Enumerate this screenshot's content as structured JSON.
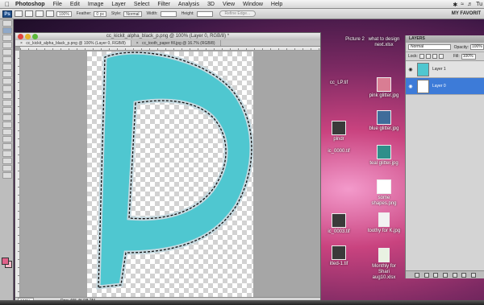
{
  "menubar": {
    "app": "Photoshop",
    "items": [
      "File",
      "Edit",
      "Image",
      "Layer",
      "Select",
      "Filter",
      "Analysis",
      "3D",
      "View",
      "Window",
      "Help"
    ],
    "clock": "Tu"
  },
  "options": {
    "app_badge": "Ps",
    "zoom": "100%",
    "feather_label": "Feather:",
    "feather_value": "0 px",
    "style_label": "Style:",
    "style_value": "Normal",
    "width_label": "Width:",
    "height_label": "Height:",
    "refine_edge_label": "Refine Edge...",
    "workspace": "MY FAVORIT"
  },
  "document": {
    "title": "cc_kickit_alpha_black_p.png @ 100% (Layer 0, RGB/8) *",
    "tabs": [
      {
        "label": "cc_kickit_alpha_black_p.png @ 100% (Layer 0, RGB/8)"
      },
      {
        "label": "cc_tooth_paper fill.jpg @ 16.7% (RGB/8)"
      }
    ],
    "status_zoom": "100%",
    "status_doc": "Doc: 455.4K/38.2M"
  },
  "desktop_icons": [
    {
      "label": "Picture 2"
    },
    {
      "label": "what to design next.xlsx"
    },
    {
      "label": "pink glitter.jpg"
    },
    {
      "label": "blue glitter.jpg"
    },
    {
      "label": "teal glitter.jpg"
    },
    {
      "label": "some shapes.png"
    },
    {
      "label": "toothy for K.jpg"
    },
    {
      "label": "Monthly for Shari aug10.xlsx"
    },
    {
      "label": "cc_LP.tif"
    },
    {
      "label": "plndr"
    },
    {
      "label": "ic_0000.tif"
    },
    {
      "label": "ic_0003.tif"
    },
    {
      "label": "itled-1.tif"
    }
  ],
  "layers_panel": {
    "title": "LAYERS",
    "blend_mode": "Normal",
    "opacity_label": "Opacity:",
    "opacity_value": "100%",
    "lock_label": "Lock:",
    "fill_label": "Fill:",
    "fill_value": "100%",
    "layers": [
      {
        "name": "Layer 1",
        "selected": false
      },
      {
        "name": "Layer 0",
        "selected": true
      }
    ]
  },
  "colors": {
    "foreground": "#e1628a",
    "background": "#f6b8c9",
    "letter_fill": "#4fc7d0",
    "selection": "#3d7bd8"
  }
}
